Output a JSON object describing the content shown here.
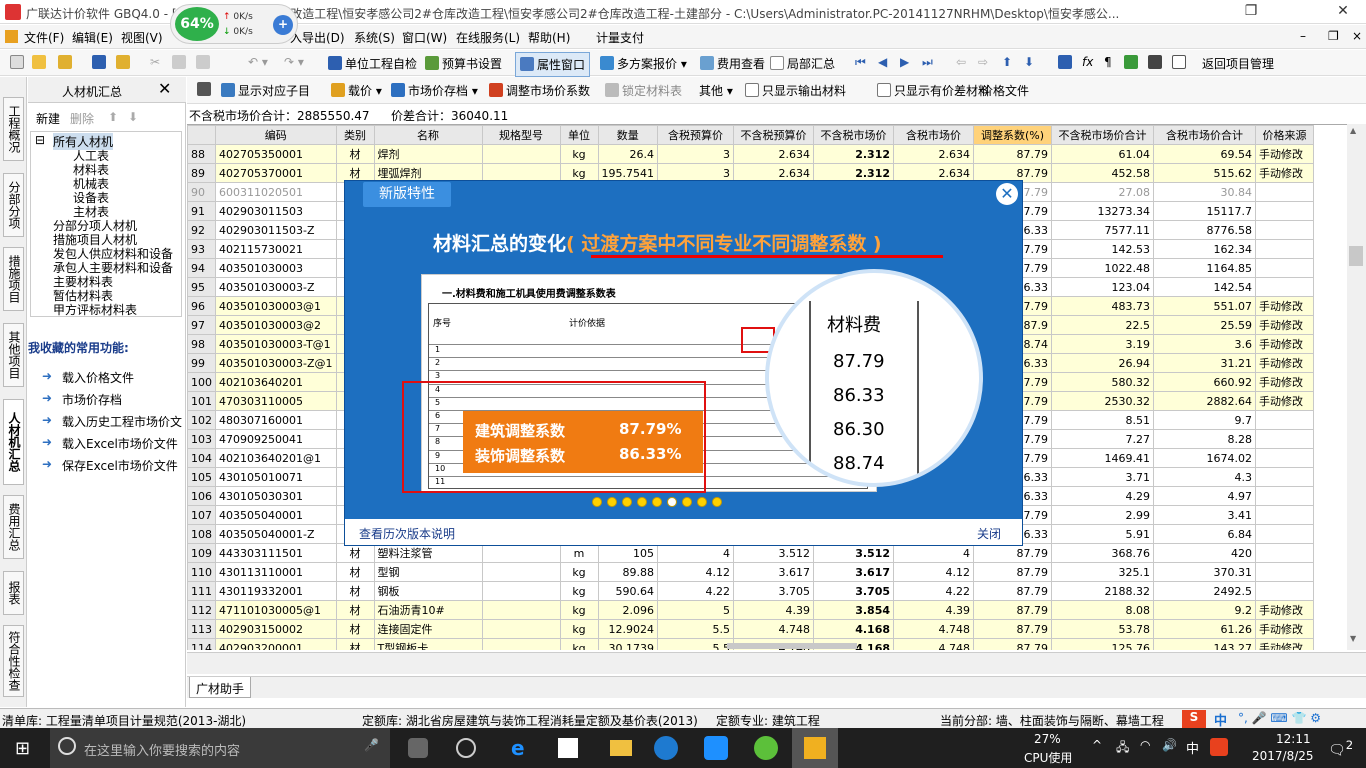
{
  "window": {
    "title": "广联达计价软件 GBQ4.0 - [恒安孝感公司2#仓库改造工程\\恒安孝感公司2#仓库改造工程\\恒安孝感公司2#仓库改造工程-土建部分 - C:\\Users\\Administrator.PC-20141127NRHM\\Desktop\\恒安孝感公..."
  },
  "speed": {
    "cpu": "64%",
    "up": "0K/s",
    "down": "0K/s"
  },
  "menu": [
    "文件(F)",
    "编辑(E)",
    "视图(V)",
    "入导出(D)",
    "系统(S)",
    "窗口(W)",
    "在线服务(L)",
    "帮助(H)",
    "计量支付"
  ],
  "toolbar1": [
    "单位工程自检",
    "预算书设置",
    "属性窗口",
    "多方案报价",
    "费用查看",
    "局部汇总",
    "返回项目管理"
  ],
  "lefttabs": [
    "工程概况",
    "分部分项",
    "措施项目",
    "其他项目",
    "人材机汇总",
    "费用汇总",
    "报表",
    "符合性检查"
  ],
  "panel": {
    "title": "人材机汇总",
    "new": "新建",
    "delete": "删除",
    "tree": [
      "所有人材机",
      "人工表",
      "材料表",
      "机械表",
      "设备表",
      "主材表",
      "分部分项人材机",
      "措施项目人材机",
      "发包人供应材料和设备",
      "承包人主要材料和设备",
      "主要材料表",
      "暂估材料表",
      "甲方评标材料表"
    ],
    "fav_title": "我收藏的常用功能:",
    "favs": [
      "载入价格文件",
      "市场价存档",
      "载入历史工程市场价文",
      "载入Excel市场价文件",
      "保存Excel市场价文件"
    ]
  },
  "toolbar2": [
    "显示对应子目",
    "载价",
    "市场价存档",
    "调整市场价系数",
    "锁定材料表",
    "其他",
    "只显示输出材料",
    "只显示有价差材料",
    "价格文件"
  ],
  "summary": {
    "market_label": "不含税市场价合计：",
    "market_value": "2885550.47",
    "diff_label": "价差合计：",
    "diff_value": "36040.11"
  },
  "columns": [
    "编码",
    "类别",
    "名称",
    "规格型号",
    "单位",
    "数量",
    "含税预算价",
    "不含税预算价",
    "不含税市场价",
    "含税市场价",
    "调整系数(%)",
    "不含税市场价合计",
    "含税市场价合计",
    "价格来源"
  ],
  "rows": [
    [
      "88",
      "402705350001",
      "材",
      "焊剂",
      "",
      "kg",
      "26.4",
      "3",
      "2.634",
      "2.312",
      "2.634",
      "87.79",
      "61.04",
      "69.54",
      "手动修改",
      "y"
    ],
    [
      "89",
      "402705370001",
      "材",
      "埋弧焊剂",
      "",
      "kg",
      "195.7541",
      "3",
      "2.634",
      "2.312",
      "2.634",
      "87.79",
      "452.58",
      "515.62",
      "手动修改",
      "y"
    ],
    [
      "90",
      "600311020501",
      "浆",
      "",
      "",
      "",
      "",
      "",
      "",
      "",
      "",
      "87.79",
      "27.08",
      "30.84",
      "",
      ""
    ],
    [
      "91",
      "402903011503",
      "材",
      "",
      "",
      "",
      "",
      "",
      "",
      "",
      "",
      "87.79",
      "13273.34",
      "15117.7",
      "",
      ""
    ],
    [
      "92",
      "402903011503-Z",
      "材",
      "",
      "",
      "",
      "",
      "",
      "",
      "",
      "",
      "86.33",
      "7577.11",
      "8776.58",
      "",
      ""
    ],
    [
      "93",
      "402115730021",
      "材",
      "",
      "",
      "",
      "",
      "",
      "",
      "",
      "",
      "87.79",
      "142.53",
      "162.34",
      "",
      ""
    ],
    [
      "94",
      "403501030003",
      "材",
      "",
      "",
      "",
      "",
      "",
      "",
      "",
      "",
      "87.79",
      "1022.48",
      "1164.85",
      "",
      ""
    ],
    [
      "95",
      "403501030003-Z",
      "材",
      "",
      "",
      "",
      "",
      "",
      "",
      "",
      "",
      "86.33",
      "123.04",
      "142.54",
      "",
      ""
    ],
    [
      "96",
      "403501030003@1",
      "材",
      "",
      "",
      "",
      "",
      "",
      "",
      "",
      "",
      "87.79",
      "483.73",
      "551.07",
      "手动修改",
      "y"
    ],
    [
      "97",
      "403501030003@2",
      "材",
      "",
      "",
      "",
      "",
      "",
      "",
      "",
      "",
      "87.9",
      "22.5",
      "25.59",
      "手动修改",
      "y"
    ],
    [
      "98",
      "403501030003-T@1",
      "材",
      "",
      "",
      "",
      "",
      "",
      "",
      "",
      "",
      "88.74",
      "3.19",
      "3.6",
      "手动修改",
      "y"
    ],
    [
      "99",
      "403501030003-Z@1",
      "材",
      "",
      "",
      "",
      "",
      "",
      "",
      "",
      "",
      "86.33",
      "26.94",
      "31.21",
      "手动修改",
      "y"
    ],
    [
      "100",
      "402103640201",
      "材",
      "",
      "",
      "",
      "",
      "",
      "",
      "",
      "",
      "87.79",
      "580.32",
      "660.92",
      "手动修改",
      "y"
    ],
    [
      "101",
      "470303110005",
      "材",
      "",
      "",
      "",
      "",
      "",
      "",
      "",
      "",
      "87.79",
      "2530.32",
      "2882.64",
      "手动修改",
      "y"
    ],
    [
      "102",
      "480307160001",
      "材",
      "",
      "",
      "",
      "",
      "",
      "",
      "",
      "",
      "87.79",
      "8.51",
      "9.7",
      "",
      ""
    ],
    [
      "103",
      "470909250041",
      "材",
      "",
      "",
      "",
      "",
      "",
      "",
      "",
      "",
      "87.79",
      "7.27",
      "8.28",
      "",
      ""
    ],
    [
      "104",
      "402103640201@1",
      "材",
      "",
      "",
      "",
      "",
      "",
      "",
      "",
      "",
      "87.79",
      "1469.41",
      "1674.02",
      "",
      ""
    ],
    [
      "105",
      "430105010071",
      "材",
      "",
      "",
      "",
      "",
      "",
      "",
      "",
      "",
      "86.33",
      "3.71",
      "4.3",
      "",
      ""
    ],
    [
      "106",
      "430105030301",
      "材",
      "",
      "",
      "",
      "",
      "",
      "",
      "",
      "",
      "86.33",
      "4.29",
      "4.97",
      "",
      ""
    ],
    [
      "107",
      "403505040001",
      "材",
      "",
      "",
      "",
      "",
      "",
      "",
      "",
      "",
      "87.79",
      "2.99",
      "3.41",
      "",
      ""
    ],
    [
      "108",
      "403505040001-Z",
      "材",
      "",
      "",
      "",
      "",
      "",
      "",
      "",
      "",
      "86.33",
      "5.91",
      "6.84",
      "",
      ""
    ],
    [
      "109",
      "443303111501",
      "材",
      "塑料注浆管",
      "",
      "m",
      "105",
      "4",
      "3.512",
      "3.512",
      "4",
      "87.79",
      "368.76",
      "420",
      "",
      ""
    ],
    [
      "110",
      "430113110001",
      "材",
      "型钢",
      "",
      "kg",
      "89.88",
      "4.12",
      "3.617",
      "3.617",
      "4.12",
      "87.79",
      "325.1",
      "370.31",
      "",
      ""
    ],
    [
      "111",
      "430119332001",
      "材",
      "钢板",
      "",
      "kg",
      "590.64",
      "4.22",
      "3.705",
      "3.705",
      "4.22",
      "87.79",
      "2188.32",
      "2492.5",
      "",
      ""
    ],
    [
      "112",
      "471101030005@1",
      "材",
      "石油沥青10#",
      "",
      "kg",
      "2.096",
      "5",
      "4.39",
      "3.854",
      "4.39",
      "87.79",
      "8.08",
      "9.2",
      "手动修改",
      "y"
    ],
    [
      "113",
      "402903150002",
      "材",
      "连接固定件",
      "",
      "kg",
      "12.9024",
      "5.5",
      "4.748",
      "4.168",
      "4.748",
      "87.79",
      "53.78",
      "61.26",
      "手动修改",
      "y"
    ],
    [
      "114",
      "402903200001",
      "材",
      "T型钢板卡",
      "",
      "kg",
      "30.1739",
      "5.5",
      "4.748",
      "4.168",
      "4.748",
      "87.79",
      "125.76",
      "143.27",
      "手动修改",
      "y"
    ]
  ],
  "bottom_tab": "广材助手",
  "status": {
    "a": "清单库:  工程量清单项目计量规范(2013-湖北)",
    "b": "定额库:  湖北省房屋建筑与装饰工程消耗量定额及基价表(2013)",
    "c": "定额专业:  建筑工程",
    "d": "当前分部:  墙、柱面装饰与隔断、幕墙工程"
  },
  "modal": {
    "tab": "新版特性",
    "heading_a": "材料汇总的变化",
    "heading_b": "( 过渡方案中不同专业不同调整系数 )",
    "doc_title": "一.材料费和施工机具使用费调整系数表",
    "doc_col1": "序号",
    "doc_col2": "计价依据",
    "doc_rows": [
      "1",
      "2",
      "3",
      "4",
      "5",
      "6",
      "7",
      "8",
      "9",
      "10",
      "11"
    ],
    "mag_head": "材料费",
    "mag_vals": [
      "87.79",
      "86.33",
      "86.30",
      "88.74"
    ],
    "label1": "建筑调整系数",
    "value1": "87.79%",
    "label2": "装饰调整系数",
    "value2": "86.33%",
    "history": "查看历次版本说明",
    "close": "关闭"
  },
  "taskbar": {
    "search": "在这里输入你要搜索的内容",
    "cpu": "27%",
    "cpu_label": "CPU使用",
    "ime": "中",
    "time": "12:11",
    "date": "2017/8/25",
    "notif": "2"
  }
}
